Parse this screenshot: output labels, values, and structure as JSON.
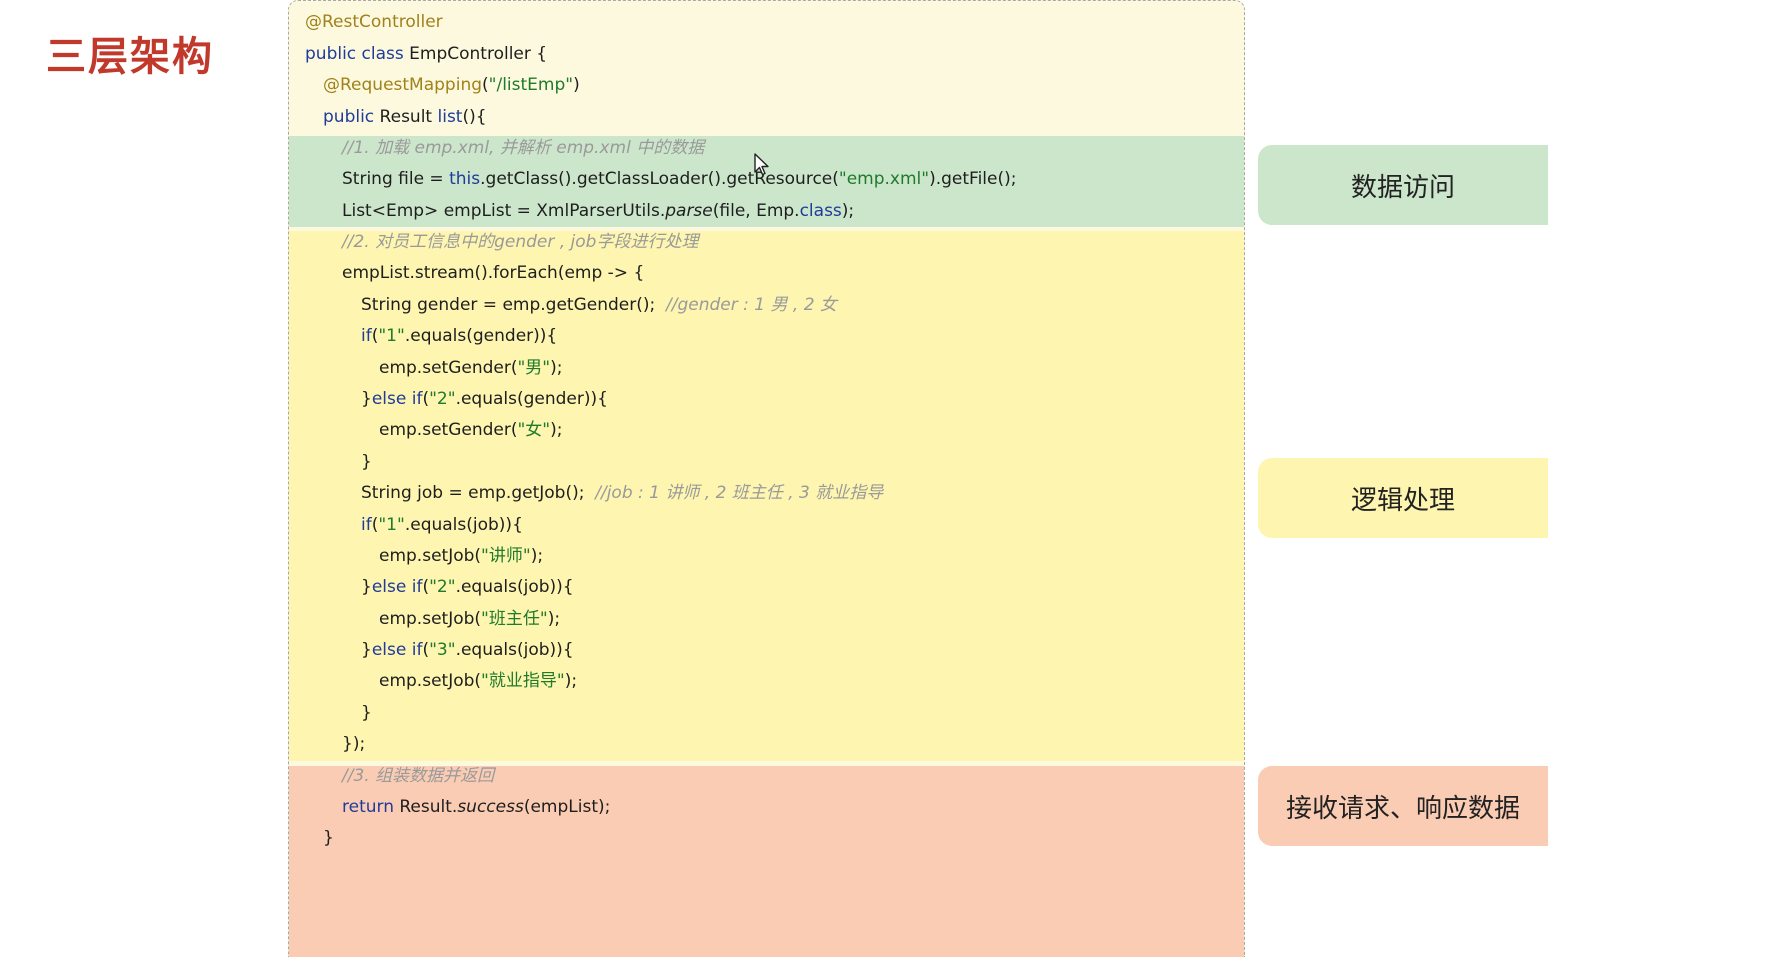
{
  "title": "三层架构",
  "colors": {
    "title": "#c0392b",
    "data_access": "#cce6cc",
    "logic": "#fdf5b0",
    "response": "#fbccb4",
    "header": "#fdf9df"
  },
  "code": {
    "l1": {
      "a": "@RestController"
    },
    "l2": {
      "a": "public class",
      "b": " EmpController {"
    },
    "l3": {
      "a": "@RequestMapping",
      "b": "(",
      "c": "\"/listEmp\"",
      "d": ")"
    },
    "l4": {
      "a": "public",
      "b": " Result ",
      "c": "list",
      "d": "(){"
    },
    "l5": {
      "a": "//1. 加载 emp.xml, 并解析 emp.xml 中的数据"
    },
    "l6": {
      "a": "String file = ",
      "b": "this",
      "c": ".getClass().getClassLoader().getResource(",
      "d": "\"emp.xml\"",
      "e": ").getFile();"
    },
    "l7": {
      "a": "List<Emp> empList = XmlParserUtils.",
      "b": "parse",
      "c": "(file, Emp.",
      "d": "class",
      "e": ");"
    },
    "l8": {
      "a": "//2. 对员工信息中的gender , job字段进行处理"
    },
    "l9": {
      "a": "empList.stream().forEach(emp -> {"
    },
    "l10": {
      "a": "String gender = emp.getGender();  ",
      "b": "//gender : 1 男 , 2 女"
    },
    "l11": {
      "a": "if",
      "b": "(",
      "c": "\"1\"",
      "d": ".equals(gender)){"
    },
    "l12": {
      "a": "emp.setGender(",
      "b": "\"男\"",
      "c": ");"
    },
    "l13": {
      "a": "}",
      "b": "else if",
      "c": "(",
      "d": "\"2\"",
      "e": ".equals(gender)){"
    },
    "l14": {
      "a": "emp.setGender(",
      "b": "\"女\"",
      "c": ");"
    },
    "l15": {
      "a": "}"
    },
    "l16": {
      "a": "String job = emp.getJob();  ",
      "b": "//job : 1 讲师 , 2 班主任 , 3 就业指导"
    },
    "l17": {
      "a": "if",
      "b": "(",
      "c": "\"1\"",
      "d": ".equals(job)){"
    },
    "l18": {
      "a": "emp.setJob(",
      "b": "\"讲师\"",
      "c": ");"
    },
    "l19": {
      "a": "}",
      "b": "else if",
      "c": "(",
      "d": "\"2\"",
      "e": ".equals(job)){"
    },
    "l20": {
      "a": "emp.setJob(",
      "b": "\"班主任\"",
      "c": ");"
    },
    "l21": {
      "a": "}",
      "b": "else if",
      "c": "(",
      "d": "\"3\"",
      "e": ".equals(job)){"
    },
    "l22": {
      "a": "emp.setJob(",
      "b": "\"就业指导\"",
      "c": ");"
    },
    "l23": {
      "a": "}"
    },
    "l24": {
      "a": "});"
    },
    "l25": {
      "a": "//3. 组装数据并返回"
    },
    "l26": {
      "a": "return",
      "b": " Result.",
      "c": "success",
      "d": "(empList);"
    },
    "l27": {
      "a": "}"
    }
  },
  "labels": {
    "data_access": "数据访问",
    "logic": "逻辑处理",
    "response": "接收请求、响应数据"
  },
  "icons": {
    "cursor": "mouse-pointer-icon"
  }
}
